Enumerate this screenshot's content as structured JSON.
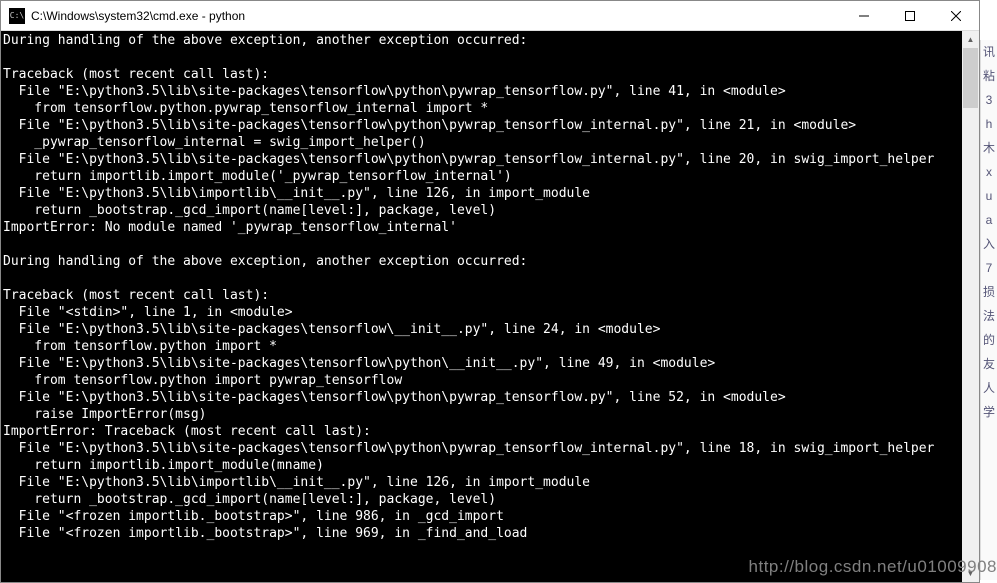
{
  "window": {
    "title": "C:\\Windows\\system32\\cmd.exe - python",
    "icon_label": "C:\\"
  },
  "terminal_lines": [
    "During handling of the above exception, another exception occurred:",
    "",
    "Traceback (most recent call last):",
    "  File \"E:\\python3.5\\lib\\site-packages\\tensorflow\\python\\pywrap_tensorflow.py\", line 41, in <module>",
    "    from tensorflow.python.pywrap_tensorflow_internal import *",
    "  File \"E:\\python3.5\\lib\\site-packages\\tensorflow\\python\\pywrap_tensorflow_internal.py\", line 21, in <module>",
    "    _pywrap_tensorflow_internal = swig_import_helper()",
    "  File \"E:\\python3.5\\lib\\site-packages\\tensorflow\\python\\pywrap_tensorflow_internal.py\", line 20, in swig_import_helper",
    "    return importlib.import_module('_pywrap_tensorflow_internal')",
    "  File \"E:\\python3.5\\lib\\importlib\\__init__.py\", line 126, in import_module",
    "    return _bootstrap._gcd_import(name[level:], package, level)",
    "ImportError: No module named '_pywrap_tensorflow_internal'",
    "",
    "During handling of the above exception, another exception occurred:",
    "",
    "Traceback (most recent call last):",
    "  File \"<stdin>\", line 1, in <module>",
    "  File \"E:\\python3.5\\lib\\site-packages\\tensorflow\\__init__.py\", line 24, in <module>",
    "    from tensorflow.python import *",
    "  File \"E:\\python3.5\\lib\\site-packages\\tensorflow\\python\\__init__.py\", line 49, in <module>",
    "    from tensorflow.python import pywrap_tensorflow",
    "  File \"E:\\python3.5\\lib\\site-packages\\tensorflow\\python\\pywrap_tensorflow.py\", line 52, in <module>",
    "    raise ImportError(msg)",
    "ImportError: Traceback (most recent call last):",
    "  File \"E:\\python3.5\\lib\\site-packages\\tensorflow\\python\\pywrap_tensorflow_internal.py\", line 18, in swig_import_helper",
    "    return importlib.import_module(mname)",
    "  File \"E:\\python3.5\\lib\\importlib\\__init__.py\", line 126, in import_module",
    "    return _bootstrap._gcd_import(name[level:], package, level)",
    "  File \"<frozen importlib._bootstrap>\", line 986, in _gcd_import",
    "  File \"<frozen importlib._bootstrap>\", line 969, in _find_and_load"
  ],
  "watermark": "http://blog.csdn.net/u01009908",
  "side_chars": "讯 粘 3 h 木 x u a 入 7 损 法 的 友 人 学"
}
